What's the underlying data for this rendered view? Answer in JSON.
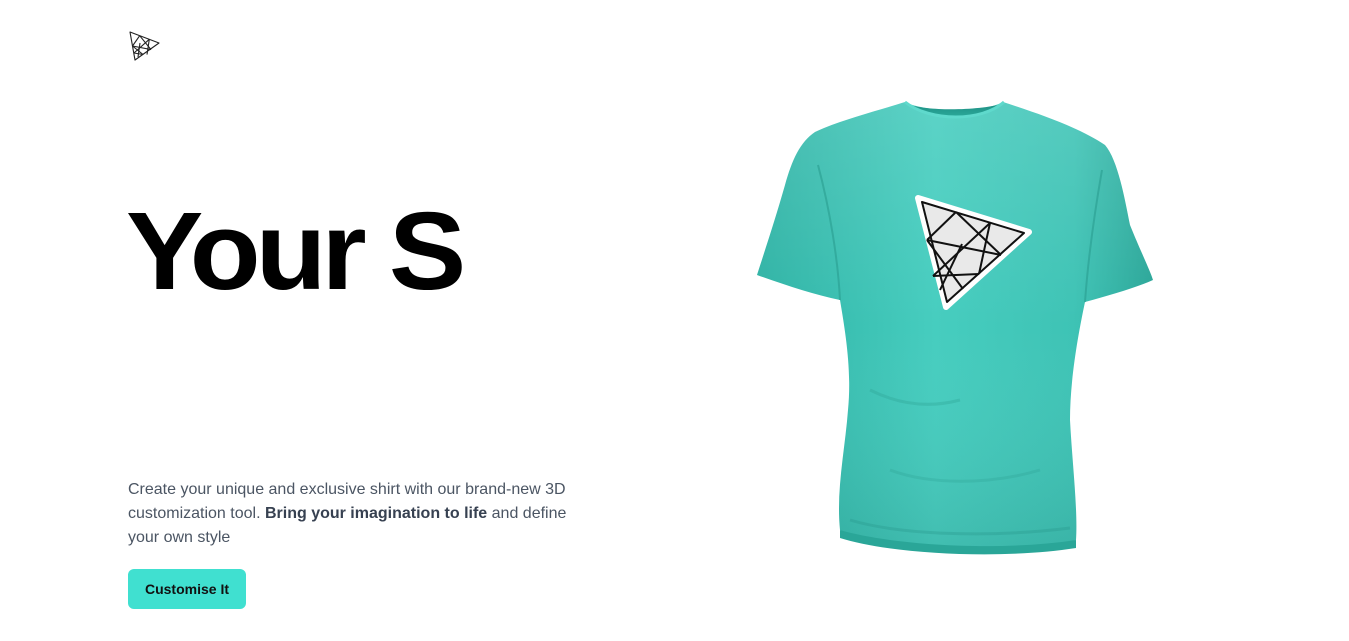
{
  "header": {
    "logo_icon": "triangle-mesh-logo-icon"
  },
  "hero": {
    "headline": "Your S",
    "description_prefix": "Create your unique and exclusive shirt with our brand-new 3D customization tool.",
    "description_bold": "Bring your imagination to life",
    "description_suffix": "and define your own style",
    "cta_label": "Customise It"
  },
  "viewer": {
    "model": "t-shirt-3d-model",
    "decal_icon": "triangle-mesh-decal-icon",
    "shirt_color": "#3ec8b9",
    "accent_color": "#40e0d0"
  }
}
